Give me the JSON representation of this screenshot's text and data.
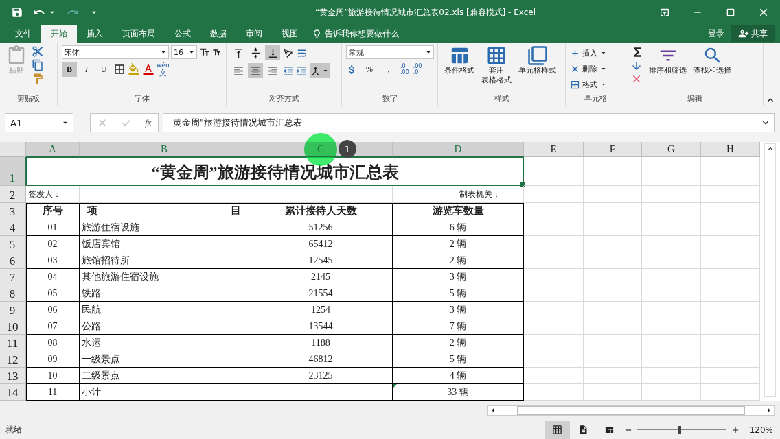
{
  "title_bar": {
    "title": "“黄金周”旅游接待情况城市汇总表02.xls  [兼容模式] - Excel"
  },
  "menu": {
    "tabs": [
      {
        "label": "文件",
        "selected": false
      },
      {
        "label": "开始",
        "selected": true
      },
      {
        "label": "插入",
        "selected": false
      },
      {
        "label": "页面布局",
        "selected": false
      },
      {
        "label": "公式",
        "selected": false
      },
      {
        "label": "数据",
        "selected": false
      },
      {
        "label": "审阅",
        "selected": false
      },
      {
        "label": "视图",
        "selected": false
      }
    ],
    "tell_me": "告诉我你想要做什么",
    "sign_in": "登录",
    "share": "共享"
  },
  "ribbon": {
    "clipboard": {
      "label": "剪贴板",
      "paste": "粘贴"
    },
    "font": {
      "label": "字体",
      "font_name": "宋体",
      "font_size": "16",
      "styles": [
        {
          "text": "B",
          "selected": true
        },
        {
          "text": "I",
          "selected": false
        },
        {
          "text": "U",
          "selected": false
        }
      ],
      "phonetic": "wén",
      "phonetic_char": "文"
    },
    "alignment": {
      "label": "对齐方式",
      "vertical": [
        {
          "kind": "top",
          "selected": false
        },
        {
          "kind": "middle",
          "selected": false
        },
        {
          "kind": "bottom",
          "selected": true
        }
      ],
      "horizontal": [
        {
          "kind": "left",
          "selected": false
        },
        {
          "kind": "center",
          "selected": true
        },
        {
          "kind": "right",
          "selected": false
        }
      ],
      "merge_selected": true
    },
    "number": {
      "label": "数字",
      "format": "常规",
      "percent": "%",
      "comma": ",",
      "decimals": [
        {
          "top": ".0",
          "bottom": ".00"
        },
        {
          "top": ".00",
          "bottom": ".0"
        }
      ]
    },
    "styles": {
      "label": "样式",
      "buttons": [
        {
          "lines": [
            "条件格式"
          ]
        },
        {
          "lines": [
            "套用",
            "表格格式"
          ]
        },
        {
          "lines": [
            "单元格样式"
          ]
        }
      ]
    },
    "cells": {
      "label": "单元格",
      "buttons": [
        "插入",
        "删除",
        "格式"
      ]
    },
    "editing": {
      "label": "编辑",
      "buttons": [
        "排序和筛选",
        "查找和选择"
      ]
    }
  },
  "formula_bar": {
    "name_box": "A1",
    "fx": "fx",
    "formula": "黄金周\"旅游接待情况城市汇总表"
  },
  "sheet": {
    "columns": [
      {
        "label": "A",
        "selected": true
      },
      {
        "label": "B",
        "selected": true
      },
      {
        "label": "C",
        "selected": true
      },
      {
        "label": "D",
        "selected": true
      },
      {
        "label": "E",
        "selected": false
      },
      {
        "label": "F",
        "selected": false
      },
      {
        "label": "G",
        "selected": false
      },
      {
        "label": "H",
        "selected": false
      }
    ],
    "row_numbers": [
      {
        "label": "1",
        "selected": true
      },
      {
        "label": "2",
        "selected": false
      },
      {
        "label": "3",
        "selected": false
      },
      {
        "label": "4",
        "selected": false
      },
      {
        "label": "5",
        "selected": false
      },
      {
        "label": "6",
        "selected": false
      },
      {
        "label": "7",
        "selected": false
      },
      {
        "label": "8",
        "selected": false
      },
      {
        "label": "9",
        "selected": false
      },
      {
        "label": "10",
        "selected": false
      },
      {
        "label": "11",
        "selected": false
      },
      {
        "label": "12",
        "selected": false
      },
      {
        "label": "13",
        "selected": false
      },
      {
        "label": "14",
        "selected": false
      }
    ],
    "title": "“黄金周”旅游接待情况城市汇总表",
    "issuer": "签发人：",
    "compiler": "制表机关：",
    "header": [
      "序号",
      "项 目",
      "累计接待人天数",
      "游览车数量"
    ],
    "rows": [
      {
        "cells": [
          "01",
          "旅游住宿设施",
          "51256",
          "6 辆"
        ],
        "error_marker": false
      },
      {
        "cells": [
          "02",
          "饭店宾馆",
          "65412",
          "2 辆"
        ],
        "error_marker": false
      },
      {
        "cells": [
          "03",
          "旅馆招待所",
          "12545",
          "2 辆"
        ],
        "error_marker": false
      },
      {
        "cells": [
          "04",
          "其他旅游住宿设施",
          "2145",
          "3 辆"
        ],
        "error_marker": false
      },
      {
        "cells": [
          "05",
          "铁路",
          "21554",
          "5 辆"
        ],
        "error_marker": false
      },
      {
        "cells": [
          "06",
          "民航",
          "1254",
          "3 辆"
        ],
        "error_marker": false
      },
      {
        "cells": [
          "07",
          "公路",
          "13544",
          "7 辆"
        ],
        "error_marker": false
      },
      {
        "cells": [
          "08",
          "水运",
          "1188",
          "2 辆"
        ],
        "error_marker": false
      },
      {
        "cells": [
          "09",
          "一级景点",
          "46812",
          "5 辆"
        ],
        "error_marker": false
      },
      {
        "cells": [
          "10",
          "二级景点",
          "23125",
          "4 辆"
        ],
        "error_marker": false
      },
      {
        "cells": [
          "11",
          "小计",
          "",
          "33 辆"
        ],
        "error_marker": true
      }
    ]
  },
  "click_marker": {
    "badge": "1"
  },
  "status_bar": {
    "status": "就绪",
    "views": [
      {
        "kind": "normal",
        "selected": true
      },
      {
        "kind": "page_layout",
        "selected": false
      },
      {
        "kind": "page_break",
        "selected": false
      }
    ],
    "zoom_slider": {
      "level": 0.48
    },
    "zoom": "120%"
  }
}
